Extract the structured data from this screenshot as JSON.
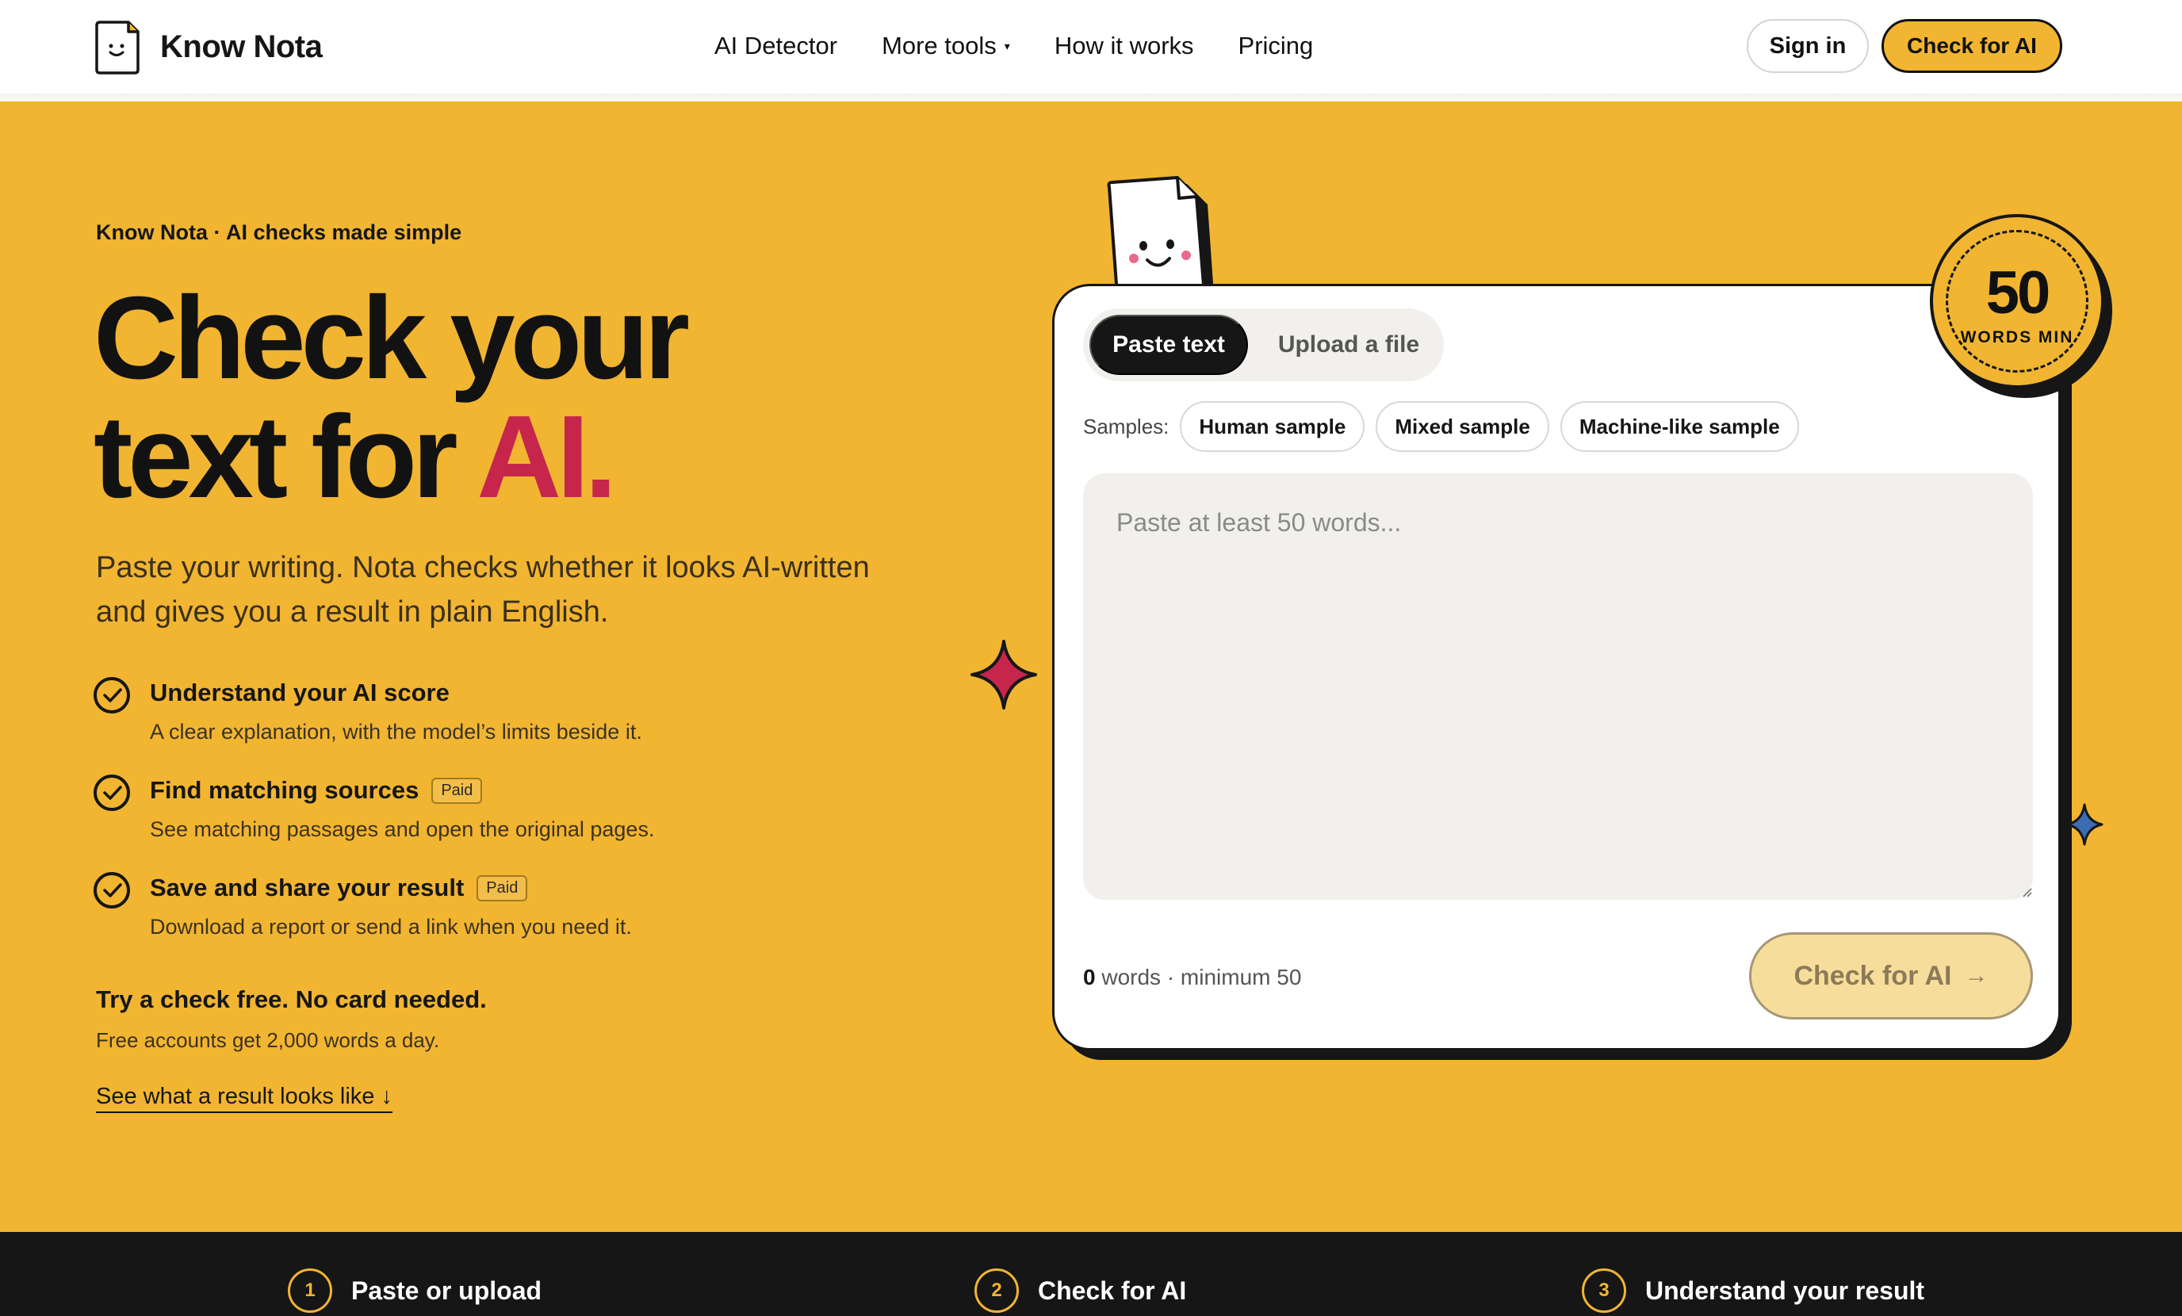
{
  "header": {
    "brand": "Know Nota",
    "nav": [
      "AI Detector",
      "More tools",
      "How it works",
      "Pricing"
    ],
    "sign_in": "Sign in",
    "cta": "Check for AI"
  },
  "hero": {
    "eyebrow": "Know Nota · AI checks made simple",
    "headline_line1": "Check your",
    "headline_line2_prefix": "text for ",
    "headline_accent": "AI.",
    "subhead": "Paste your writing. Nota checks whether it looks AI-written and gives you a result in plain English.",
    "features": [
      {
        "title": "Understand your AI score",
        "desc": "A clear explanation, with the model’s limits beside it.",
        "badge": ""
      },
      {
        "title": "Find matching sources",
        "desc": "See matching passages and open the original pages.",
        "badge": "Paid"
      },
      {
        "title": "Save and share your result",
        "desc": "Download a report or send a link when you need it.",
        "badge": "Paid"
      }
    ],
    "free_title": "Try a check free. No card needed.",
    "free_desc": "Free accounts get 2,000 words a day.",
    "result_link": "See what a result looks like ↓"
  },
  "checker": {
    "tabs": {
      "active": "Paste text",
      "inactive": "Upload a file"
    },
    "samples_label": "Samples:",
    "samples": [
      "Human sample",
      "Mixed sample",
      "Machine-like sample"
    ],
    "textarea_placeholder": "Paste at least 50 words...",
    "word_count": "0",
    "word_count_suffix": "words · minimum 50",
    "submit": "Check for AI",
    "submit_arrow": "→",
    "badge_number": "50",
    "badge_text": "WORDS MIN"
  },
  "steps": [
    {
      "num": "1",
      "label": "Paste or upload"
    },
    {
      "num": "2",
      "label": "Check for AI"
    },
    {
      "num": "3",
      "label": "Understand your result"
    }
  ],
  "colors": {
    "brand_yellow": "#f1b532",
    "accent_red": "#c6264c",
    "ink": "#161616",
    "sparkle_blue": "#3c6db3"
  }
}
